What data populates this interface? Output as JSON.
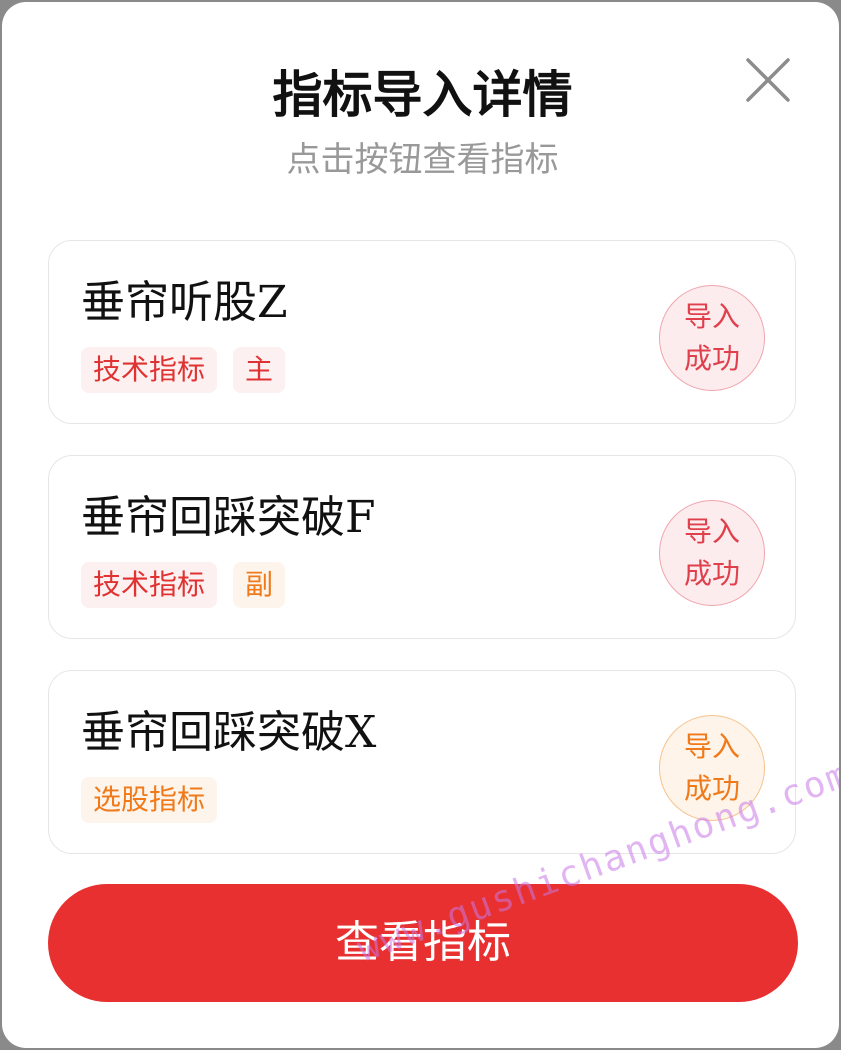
{
  "modal": {
    "title": "指标导入详情",
    "subtitle": "点击按钮查看指标",
    "close_icon": "close-icon"
  },
  "cards": [
    {
      "name": "垂帘听股Z",
      "tags": [
        {
          "label": "技术指标",
          "color": "#e03232"
        },
        {
          "label": "主",
          "color": "#e03232"
        }
      ],
      "status": {
        "line1": "导入",
        "line2": "成功",
        "color": "#e0404c"
      }
    },
    {
      "name": "垂帘回踩突破F",
      "tags": [
        {
          "label": "技术指标",
          "color": "#e03232"
        },
        {
          "label": "副",
          "color": "#f07a1a"
        }
      ],
      "status": {
        "line1": "导入",
        "line2": "成功",
        "color": "#e0404c"
      }
    },
    {
      "name": "垂帘回踩突破X",
      "tags": [
        {
          "label": "选股指标",
          "color": "#f07a1a"
        }
      ],
      "status": {
        "line1": "导入",
        "line2": "成功",
        "color": "#f07a1a"
      }
    }
  ],
  "footer": {
    "view_button_label": "查看指标",
    "button_color": "#e83030"
  },
  "watermark": "www.gushichanghong.com"
}
